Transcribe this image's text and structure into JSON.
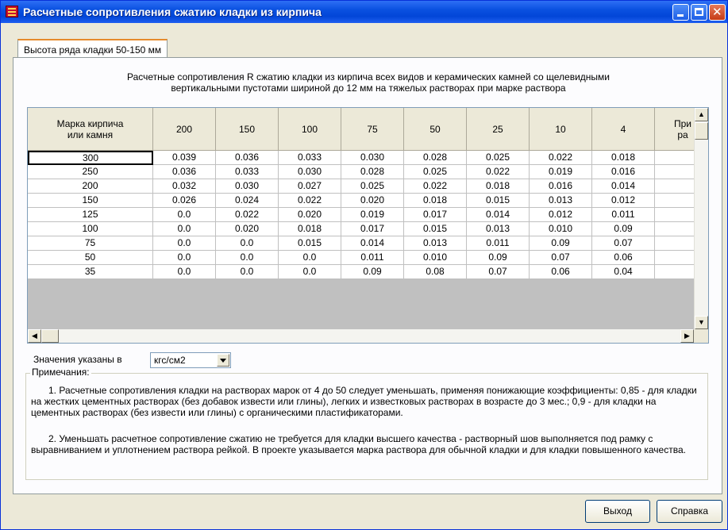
{
  "window": {
    "title": "Расчетные сопротивления сжатию кладки из кирпича"
  },
  "tab": {
    "label": "Высота ряда кладки 50-150 мм"
  },
  "description": {
    "line1": "Расчетные сопротивления R сжатию кладки из кирпича всех видов и керамических камней со щелевидными",
    "line2": "вертикальными пустотами шириной до 12 мм на тяжелых растворах при марке раствора"
  },
  "table": {
    "header_first_line1": "Марка кирпича",
    "header_first_line2": "или камня",
    "columns": [
      "200",
      "150",
      "100",
      "75",
      "50",
      "25",
      "10",
      "4"
    ],
    "clipped_header_line1": "При",
    "clipped_header_line2": "ра",
    "rows": [
      {
        "brand": "300",
        "values": [
          "0.039",
          "0.036",
          "0.033",
          "0.030",
          "0.028",
          "0.025",
          "0.022",
          "0.018"
        ]
      },
      {
        "brand": "250",
        "values": [
          "0.036",
          "0.033",
          "0.030",
          "0.028",
          "0.025",
          "0.022",
          "0.019",
          "0.016"
        ]
      },
      {
        "brand": "200",
        "values": [
          "0.032",
          "0.030",
          "0.027",
          "0.025",
          "0.022",
          "0.018",
          "0.016",
          "0.014"
        ]
      },
      {
        "brand": "150",
        "values": [
          "0.026",
          "0.024",
          "0.022",
          "0.020",
          "0.018",
          "0.015",
          "0.013",
          "0.012"
        ]
      },
      {
        "brand": "125",
        "values": [
          "0.0",
          "0.022",
          "0.020",
          "0.019",
          "0.017",
          "0.014",
          "0.012",
          "0.011"
        ]
      },
      {
        "brand": "100",
        "values": [
          "0.0",
          "0.020",
          "0.018",
          "0.017",
          "0.015",
          "0.013",
          "0.010",
          "0.09"
        ]
      },
      {
        "brand": "75",
        "values": [
          "0.0",
          "0.0",
          "0.015",
          "0.014",
          "0.013",
          "0.011",
          "0.09",
          "0.07"
        ]
      },
      {
        "brand": "50",
        "values": [
          "0.0",
          "0.0",
          "0.0",
          "0.011",
          "0.010",
          "0.09",
          "0.07",
          "0.06"
        ]
      },
      {
        "brand": "35",
        "values": [
          "0.0",
          "0.0",
          "0.0",
          "0.09",
          "0.08",
          "0.07",
          "0.06",
          "0.04"
        ]
      }
    ]
  },
  "units": {
    "label": "Значения указаны в",
    "selected": "кгс/см2"
  },
  "notes": {
    "legend": "Примечания:",
    "note1": "1. Расчетные сопротивления кладки на растворах марок от 4 до 50 следует уменьшать, применяя понижающие коэффициенты: 0,85 - для кладки на жестких цементных растворах (без добавок извести или глины), легких и известковых растворах в возрасте до 3 мес.; 0,9 - для кладки на цементных растворах (без извести или глины) с органическими пластификаторами.",
    "note2": "2. Уменьшать расчетное сопротивление сжатию не требуется для кладки высшего качества - растворный шов выполняется под рамку с выравниванием и уплотнением раствора рейкой. В проекте указывается марка раствора для обычной кладки и для кладки повышенного качества."
  },
  "buttons": {
    "exit": "Выход",
    "help": "Справка"
  },
  "colors": {
    "titlebar": "#0a51e0",
    "window_bg": "#ece9d8",
    "grid_empty": "#c0c0c0"
  }
}
